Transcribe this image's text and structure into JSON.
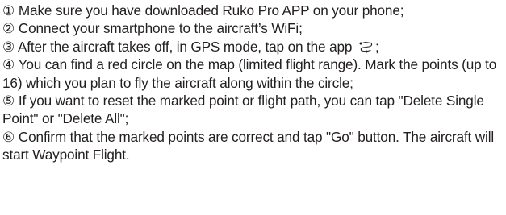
{
  "instructions": {
    "steps": [
      {
        "number": "①",
        "text": " Make sure you have downloaded Ruko Pro APP on your phone;"
      },
      {
        "number": "②",
        "text": " Connect your smartphone to the aircraft’s WiFi;"
      },
      {
        "number": "③",
        "text": " After the aircraft takes off, in GPS mode, tap on the app ",
        "icon": "waypoint-path-icon",
        "text_after": ";"
      },
      {
        "number": "④",
        "text": " You can find a red circle on the map (limited flight range). Mark the points (up to 16) which  you plan to fly the aircraft along within the circle;"
      },
      {
        "number": "⑤",
        "text": " If you want to reset the marked point or flight path, you can tap \"Delete Single Point\" or \"Delete All\";"
      },
      {
        "number": "⑥",
        "text": " Confirm that the marked points are correct and tap \"Go\" button. The aircraft will start  Waypoint Flight."
      }
    ]
  }
}
